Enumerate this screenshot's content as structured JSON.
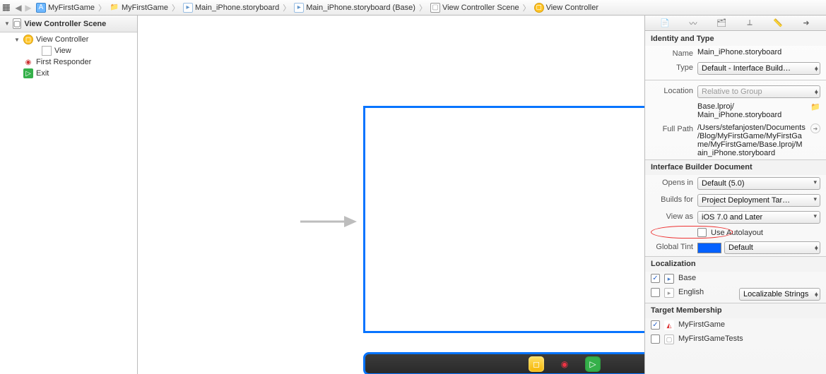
{
  "breadcrumb": {
    "items": [
      {
        "icon": "project",
        "label": "MyFirstGame"
      },
      {
        "icon": "folder",
        "label": "MyFirstGame"
      },
      {
        "icon": "storyboard",
        "label": "Main_iPhone.storyboard"
      },
      {
        "icon": "storyboard",
        "label": "Main_iPhone.storyboard (Base)"
      },
      {
        "icon": "scene",
        "label": "View Controller Scene"
      },
      {
        "icon": "vc",
        "label": "View Controller"
      }
    ]
  },
  "outline": {
    "title": "View Controller Scene",
    "nodes": {
      "vc": "View Controller",
      "view": "View",
      "first_responder": "First Responder",
      "exit": "Exit"
    }
  },
  "inspector": {
    "identity": {
      "section": "Identity and Type",
      "name_label": "Name",
      "name_value": "Main_iPhone.storyboard",
      "type_label": "Type",
      "type_value": "Default - Interface Build…",
      "location_label": "Location",
      "location_value": "Relative to Group",
      "location_path": "Base.lproj/\nMain_iPhone.storyboard",
      "fullpath_label": "Full Path",
      "fullpath_value": "/Users/stefanjosten/Documents/Blog/MyFirstGame/MyFirstGame/MyFirstGame/Base.lproj/Main_iPhone.storyboard"
    },
    "ibdoc": {
      "section": "Interface Builder Document",
      "opens_label": "Opens in",
      "opens_value": "Default (5.0)",
      "builds_label": "Builds for",
      "builds_value": "Project Deployment Tar…",
      "viewas_label": "View as",
      "viewas_value": "iOS 7.0 and Later",
      "autolayout_label": "Use Autolayout",
      "tint_label": "Global Tint",
      "tint_value": "Default"
    },
    "localization": {
      "section": "Localization",
      "base": "Base",
      "english": "English",
      "english_mode": "Localizable Strings"
    },
    "membership": {
      "section": "Target Membership",
      "t1": "MyFirstGame",
      "t2": "MyFirstGameTests"
    }
  }
}
